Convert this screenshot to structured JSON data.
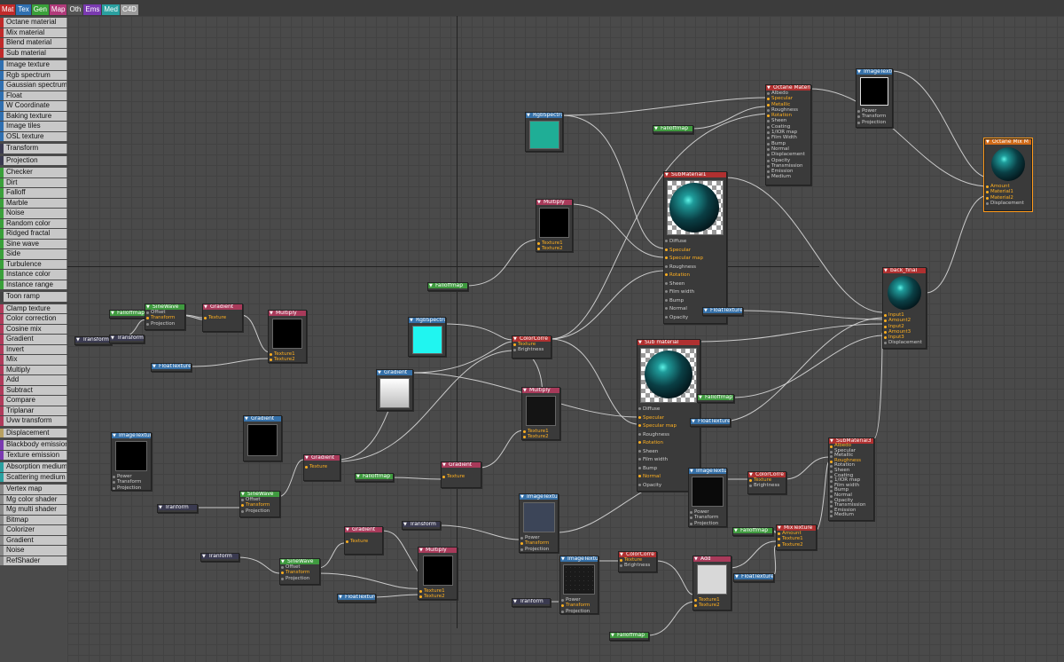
{
  "tabs": [
    {
      "label": "Mat",
      "color": "#c02a2a"
    },
    {
      "label": "Tex",
      "color": "#2f6fb0"
    },
    {
      "label": "Gen",
      "color": "#3aa03a"
    },
    {
      "label": "Map",
      "color": "#b03a7a"
    },
    {
      "label": "Oth",
      "color": "#555555"
    },
    {
      "label": "Ems",
      "color": "#7a3ab0"
    },
    {
      "label": "Med",
      "color": "#2aa0a0"
    },
    {
      "label": "C4D",
      "color": "#9a9a9a"
    }
  ],
  "palette": [
    {
      "label": "Octane material",
      "color": "#c02a2a"
    },
    {
      "label": "Mix material",
      "color": "#c02a2a"
    },
    {
      "label": "Blend material",
      "color": "#c02a2a"
    },
    {
      "label": "Sub material",
      "color": "#c02a2a"
    },
    {
      "label": "Image texture",
      "color": "#2f6fb0",
      "gap": true
    },
    {
      "label": "Rgb spectrum",
      "color": "#2f6fb0"
    },
    {
      "label": "Gaussian spectrum",
      "color": "#2f6fb0"
    },
    {
      "label": "Float",
      "color": "#2f6fb0"
    },
    {
      "label": "W Coordinate",
      "color": "#2f6fb0"
    },
    {
      "label": "Baking texture",
      "color": "#2f6fb0"
    },
    {
      "label": "Image tiles",
      "color": "#2f6fb0"
    },
    {
      "label": "OSL texture",
      "color": "#2f6fb0"
    },
    {
      "label": "Transform",
      "color": "#3a3a50",
      "gap": true
    },
    {
      "label": "Projection",
      "color": "#3a3a50",
      "gap": true
    },
    {
      "label": "Checker",
      "color": "#3aa03a",
      "gap": true
    },
    {
      "label": "Dirt",
      "color": "#3aa03a"
    },
    {
      "label": "Falloff",
      "color": "#3aa03a"
    },
    {
      "label": "Marble",
      "color": "#3aa03a"
    },
    {
      "label": "Noise",
      "color": "#3aa03a"
    },
    {
      "label": "Random color",
      "color": "#3aa03a"
    },
    {
      "label": "Ridged fractal",
      "color": "#3aa03a"
    },
    {
      "label": "Sine wave",
      "color": "#3aa03a"
    },
    {
      "label": "Side",
      "color": "#3aa03a"
    },
    {
      "label": "Turbulence",
      "color": "#3aa03a"
    },
    {
      "label": "Instance color",
      "color": "#3aa03a"
    },
    {
      "label": "Instance range",
      "color": "#3aa03a"
    },
    {
      "label": "Toon ramp",
      "color": "#444444",
      "gap": true
    },
    {
      "label": "Clamp texture",
      "color": "#b03a5a",
      "gap": true
    },
    {
      "label": "Color correction",
      "color": "#b03a5a"
    },
    {
      "label": "Cosine mix",
      "color": "#b03a5a"
    },
    {
      "label": "Gradient",
      "color": "#b03a5a"
    },
    {
      "label": "Invert",
      "color": "#b03a5a"
    },
    {
      "label": "Mix",
      "color": "#b03a5a"
    },
    {
      "label": "Multiply",
      "color": "#b03a5a"
    },
    {
      "label": "Add",
      "color": "#b03a5a"
    },
    {
      "label": "Subtract",
      "color": "#b03a5a"
    },
    {
      "label": "Compare",
      "color": "#b03a5a"
    },
    {
      "label": "Triplanar",
      "color": "#b03a5a"
    },
    {
      "label": "Uvw transform",
      "color": "#b03a5a"
    },
    {
      "label": "Displacement",
      "color": "#b8a060",
      "gap": true
    },
    {
      "label": "Blackbody emission",
      "color": "#7a3ab0",
      "gap": true
    },
    {
      "label": "Texture emission",
      "color": "#7a3ab0"
    },
    {
      "label": "Absorption medium",
      "color": "#2aa0a0",
      "gap": true
    },
    {
      "label": "Scattering medium",
      "color": "#2aa0a0"
    },
    {
      "label": "Vertex map",
      "color": "#888888",
      "gap": true
    },
    {
      "label": "Mg color shader",
      "color": "#888888"
    },
    {
      "label": "Mg multi shader",
      "color": "#888888"
    },
    {
      "label": "Bitmap",
      "color": "#888888"
    },
    {
      "label": "Colorizer",
      "color": "#888888"
    },
    {
      "label": "Gradient",
      "color": "#888888"
    },
    {
      "label": "Noise",
      "color": "#888888"
    },
    {
      "label": "RefShader",
      "color": "#888888"
    }
  ],
  "nodes": {
    "imagetex_top": {
      "title": "ImageTexture",
      "pins": [
        "Power",
        "Transform",
        "Projection"
      ]
    },
    "octane_material": {
      "title": "Octane Material",
      "pins": [
        "Albedo",
        "Specular",
        "Metallic",
        "Roughness",
        "Rotation",
        "Sheen",
        "Coating",
        "1/IOR map",
        "Film Width",
        "Bump",
        "Normal",
        "Displacement",
        "Opacity",
        "Transmission",
        "Emission",
        "Medium"
      ]
    },
    "octane_mix": {
      "title": "Octane Mix M",
      "pins": [
        "Amount",
        "Material1",
        "Material2",
        "Displacement"
      ]
    },
    "rgbspectrum_top": {
      "title": "RgbSpectrum"
    },
    "falloffmap_top": {
      "title": "Falloffmap"
    },
    "submaterial1": {
      "title": "SubMaterial1",
      "pins": [
        "Diffuse",
        "Specular",
        "Specular map",
        "Roughness",
        "Rotation",
        "Sheen",
        "Film width",
        "Bump",
        "Normal",
        "Opacity"
      ]
    },
    "multiply_mid": {
      "title": "Multiply",
      "pins": [
        "Texture1",
        "Texture2"
      ]
    },
    "falloffmap_mid": {
      "title": "Falloffmap"
    },
    "back_final": {
      "title": "back_final",
      "pins": [
        "Input1",
        "Amount2",
        "Input2",
        "Amount3",
        "Input3",
        "Displacement"
      ]
    },
    "floattexture_mid": {
      "title": "FloatTexture"
    },
    "falloffmap_left": {
      "title": "Falloffmap"
    },
    "sinewave_left": {
      "title": "SineWave",
      "pins": [
        "Offset",
        "Transform",
        "Projection"
      ]
    },
    "gradient_left": {
      "title": "Gradient",
      "pins": [
        "Texture"
      ]
    },
    "multiply_left": {
      "title": "Multiply",
      "pins": [
        "Texture1",
        "Texture2"
      ]
    },
    "transform_left": {
      "title": "Transform"
    },
    "transform_left2": {
      "title": "Transform"
    },
    "floattexture_left": {
      "title": "FloatTexture"
    },
    "rgbspectrum_mid": {
      "title": "RgbSpectrum"
    },
    "colorcorre_mid": {
      "title": "ColorCorre",
      "pins": [
        "Texture",
        "Brightness"
      ]
    },
    "gradient_center": {
      "title": "Gradient"
    },
    "sub_material": {
      "title": "Sub material",
      "pins": [
        "Diffuse",
        "Specular",
        "Specular map",
        "Roughness",
        "Rotation",
        "Sheen",
        "Film width",
        "Bump",
        "Normal",
        "Opacity"
      ]
    },
    "falloffmap_right": {
      "title": "Falloffmap"
    },
    "floattexture_right": {
      "title": "FloatTexture"
    },
    "multiply_center": {
      "title": "Multiply",
      "pins": [
        "Texture1",
        "Texture2"
      ]
    },
    "imagetexture_left": {
      "title": "ImageTexture",
      "pins": [
        "Power",
        "Transform",
        "Projection"
      ]
    },
    "gradient_black": {
      "title": "Gradient"
    },
    "gradient_small": {
      "title": "Gradient",
      "pins": [
        "Texture"
      ]
    },
    "falloffmap_low": {
      "title": "Falloffmap"
    },
    "gradient_low": {
      "title": "Gradient",
      "pins": [
        "Texture"
      ]
    },
    "sinewave_mid": {
      "title": "SineWave",
      "pins": [
        "Offset",
        "Transform",
        "Projection"
      ]
    },
    "transform_mid": {
      "title": "Tranform"
    },
    "imagetexture_noise": {
      "title": "ImageTexture",
      "pins": [
        "Power",
        "Transform",
        "Projection"
      ]
    },
    "colorcorre_right": {
      "title": "ColorCorre",
      "pins": [
        "Texture",
        "Brightness"
      ]
    },
    "submaterial3": {
      "title": "SubMaterial3",
      "pins": [
        "Albedo",
        "Specular",
        "Metallic",
        "Roughness",
        "Rotation",
        "Sheen",
        "Coating",
        "1/IOR map",
        "Film width",
        "Bump",
        "Normal",
        "Opacity",
        "Transmission",
        "Emission",
        "Medium"
      ]
    },
    "imagetexture_center": {
      "title": "ImageTexture",
      "pins": [
        "Power",
        "Transform",
        "Projection"
      ]
    },
    "transform_center": {
      "title": "Transform"
    },
    "gradient_bottom": {
      "title": "Gradient",
      "pins": [
        "Texture"
      ]
    },
    "transform_bottom": {
      "title": "Tranform"
    },
    "sinewave_bottom": {
      "title": "SineWave",
      "pins": [
        "Offset",
        "Transform",
        "Projection"
      ]
    },
    "multiply_bottom": {
      "title": "Multiply",
      "pins": [
        "Texture1",
        "Texture2"
      ]
    },
    "floattexture_bottom": {
      "title": "FloatTexture"
    },
    "imagetexture_bottom": {
      "title": "ImageTexture",
      "pins": [
        "Power",
        "Transform",
        "Projection"
      ]
    },
    "colorcorre_bottom": {
      "title": "ColorCorre",
      "pins": [
        "Texture",
        "Brightness"
      ]
    },
    "transform_bottom2": {
      "title": "Tranform"
    },
    "add_node": {
      "title": "Add",
      "pins": [
        "Texture1",
        "Texture2"
      ]
    },
    "falloffmap_bottom": {
      "title": "Falloffmap"
    },
    "mixtexture": {
      "title": "MixTexture",
      "pins": [
        "Amount",
        "Texture1",
        "Texture2"
      ]
    },
    "falloffmap_br": {
      "title": "Falloffmap"
    },
    "floattexture_br": {
      "title": "FloatTexture"
    }
  }
}
